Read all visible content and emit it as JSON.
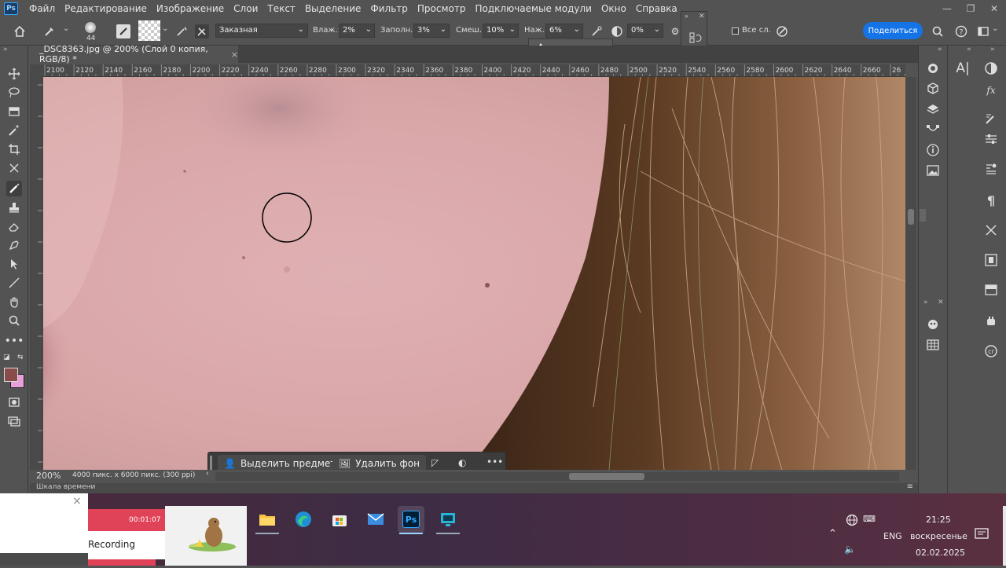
{
  "app": {
    "logo": "Ps"
  },
  "menu": [
    "Файл",
    "Редактирование",
    "Изображение",
    "Слои",
    "Текст",
    "Выделение",
    "Фильтр",
    "Просмотр",
    "Подключаемые модули",
    "Окно",
    "Справка"
  ],
  "options": {
    "brush_size": "44",
    "preset": "Заказная",
    "wetness_label": "Влаж.:",
    "wetness_value": "2%",
    "load_label": "Заполн.:",
    "load_value": "3%",
    "mix_label": "Смеш.:",
    "mix_value": "10%",
    "flow_label": "Наж.:",
    "flow_value": "6%",
    "angle_value": "0%",
    "all_layers_label": "Все сл.",
    "share_label": "Поделиться"
  },
  "document": {
    "tab_title": "_DSC8363.jpg @ 200% (Слой 0 копия, RGB/8) *",
    "zoom": "200%",
    "info": "4000 пикс. x 6000 пикс. (300 ppi)"
  },
  "ruler": {
    "top_labels": [
      "2100",
      "2120",
      "2140",
      "2160",
      "2180",
      "2200",
      "2220",
      "2240",
      "2260",
      "2280",
      "2300",
      "2320",
      "2340",
      "2360",
      "2380",
      "2400",
      "2420",
      "2440",
      "2460",
      "2480",
      "2500",
      "2520",
      "2540",
      "2560",
      "2580",
      "2600",
      "2620",
      "2640",
      "2660",
      "26"
    ]
  },
  "context_bar": {
    "select_subject": "Выделить предмет",
    "remove_bg": "Удалить фон"
  },
  "timeline_label": "Шкала времени",
  "recorder": {
    "time": "00:01:07",
    "label": "Recording"
  },
  "taskbar": {
    "lang": "ENG",
    "time": "21:25",
    "day": "воскресенье",
    "date": "02.02.2025"
  },
  "colors": {
    "accent": "#1473e6",
    "foreground_swatch": "#8a4b4b",
    "background_swatch": "#e8a0d8",
    "recorder_red": "#e04358"
  }
}
